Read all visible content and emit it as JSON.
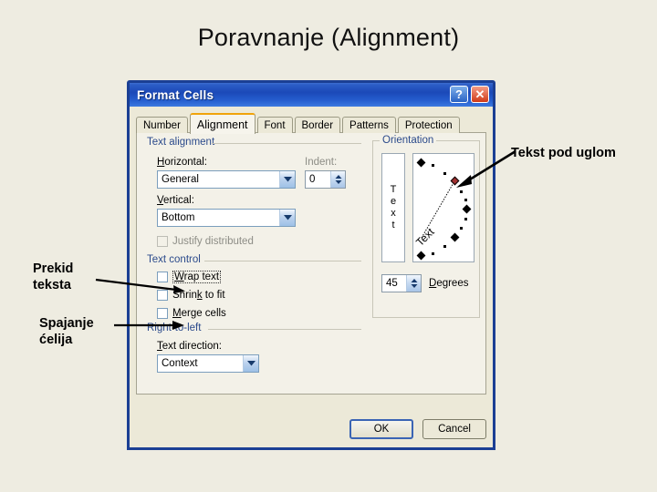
{
  "slide": {
    "title": "Poravnanje (Alignment)",
    "background_color": "#eeece1"
  },
  "annotations": [
    {
      "id": "wrap-text",
      "text": "Prekid\nteksta"
    },
    {
      "id": "merge-cells",
      "text": "Spajanje\nćelija"
    },
    {
      "id": "angled-text",
      "text": "Tekst pod uglom"
    }
  ],
  "dialog": {
    "title": "Format Cells",
    "title_bar_color": "#1b49b8",
    "accent_color": "#1b3f94",
    "titlebar_buttons": [
      {
        "name": "help-button",
        "glyph": "?"
      },
      {
        "name": "close-button",
        "glyph": "✕"
      }
    ],
    "tabs": [
      {
        "label": "Number",
        "active": false
      },
      {
        "label": "Alignment",
        "active": true
      },
      {
        "label": "Font",
        "active": false
      },
      {
        "label": "Border",
        "active": false
      },
      {
        "label": "Patterns",
        "active": false
      },
      {
        "label": "Protection",
        "active": false
      }
    ],
    "text_alignment": {
      "group_label": "Text alignment",
      "horizontal_label": "Horizontal:",
      "horizontal_value": "General",
      "vertical_label": "Vertical:",
      "vertical_value": "Bottom",
      "indent_label": "Indent:",
      "indent_value": "0",
      "justify_distributed_label": "Justify distributed",
      "justify_distributed_checked": false,
      "justify_distributed_enabled": false
    },
    "text_control": {
      "group_label": "Text control",
      "items": [
        {
          "label": "Wrap text",
          "checked": false,
          "focused": true
        },
        {
          "label": "Shrink to fit",
          "checked": false,
          "focused": false
        },
        {
          "label": "Merge cells",
          "checked": false,
          "focused": false
        }
      ]
    },
    "right_to_left": {
      "group_label": "Right-to-left",
      "text_direction_label": "Text direction:",
      "text_direction_value": "Context"
    },
    "orientation": {
      "group_label": "Orientation",
      "vertical_text_letters": "T e x t",
      "preview_word": "Text",
      "degrees_value": "45",
      "degrees_label": "Degrees",
      "selected_marker_color": "#a03030"
    },
    "buttons": {
      "ok": "OK",
      "cancel": "Cancel"
    }
  }
}
